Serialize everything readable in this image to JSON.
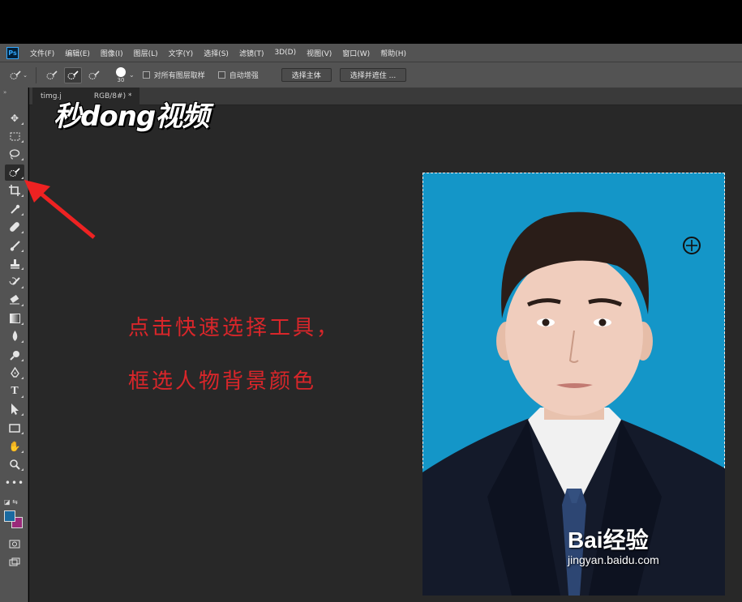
{
  "app": {
    "logo": "Ps"
  },
  "menu": [
    "文件(F)",
    "编辑(E)",
    "图像(I)",
    "图层(L)",
    "文字(Y)",
    "选择(S)",
    "滤镜(T)",
    "3D(D)",
    "视图(V)",
    "窗口(W)",
    "帮助(H)"
  ],
  "options": {
    "brush_size": "30",
    "sample_all_layers": "对所有图层取样",
    "auto_enhance": "自动增强",
    "select_subject": "选择主体",
    "select_and_mask": "选择并遮住 ..."
  },
  "document": {
    "tab_name": "timg.j",
    "tab_mode": "RGB/8#) *"
  },
  "watermark": {
    "brand": "秒dong视频"
  },
  "annotation": {
    "line1": "点击快速选择工具，",
    "line2": "框选人物背景颜色"
  },
  "baidu": {
    "brand": "Bai经验",
    "url": "jingyan.baidu.com"
  },
  "colors": {
    "foreground": "#1a6aa0",
    "background": "#9a2a7a",
    "photo_bg": "#1496c8",
    "annotation": "#d9262a"
  }
}
